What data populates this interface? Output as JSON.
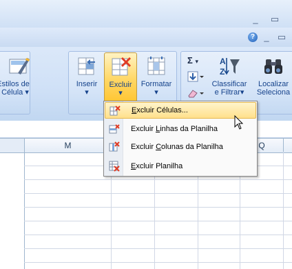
{
  "window": {
    "minimize_glyph": "_",
    "restore_glyph": "▭",
    "help_glyph": "?"
  },
  "ribbon": {
    "estilos": {
      "line1": "Estilos de",
      "line2": "Célula",
      "arrow": "▾"
    },
    "inserir": {
      "label": "Inserir",
      "arrow": "▾"
    },
    "excluir": {
      "label": "Excluir",
      "arrow": "▾"
    },
    "formatar": {
      "label": "Formatar",
      "arrow": "▾"
    },
    "sigma": {
      "glyph": "Σ",
      "arrow": "▾"
    },
    "classificar": {
      "line1": "Classificar",
      "line2": "e Filtrar",
      "arrow": "▾"
    },
    "localizar": {
      "line1": "Localizar",
      "line2": "Seleciona"
    }
  },
  "sheet": {
    "column_headers": [
      "M",
      "",
      "",
      "",
      "Q",
      ""
    ]
  },
  "delete_menu": {
    "items": [
      {
        "prefix": "",
        "accel": "E",
        "suffix": "xcluir Células...",
        "icon": "delete-cells-icon",
        "highlighted": true
      },
      {
        "prefix": "Excluir ",
        "accel": "L",
        "suffix": "inhas da Planilha",
        "icon": "delete-rows-icon",
        "highlighted": false
      },
      {
        "prefix": "Excluir ",
        "accel": "C",
        "suffix": "olunas da Planilha",
        "icon": "delete-columns-icon",
        "highlighted": false
      },
      {
        "prefix": "",
        "accel": "E",
        "suffix": "xcluir Planilha",
        "icon": "delete-sheet-icon",
        "highlighted": false
      }
    ]
  },
  "colors": {
    "ribbon_bg": "#d0e1f7",
    "highlight": "#ffe08c",
    "text_blue": "#15428b",
    "delete_red": "#e03b24"
  }
}
